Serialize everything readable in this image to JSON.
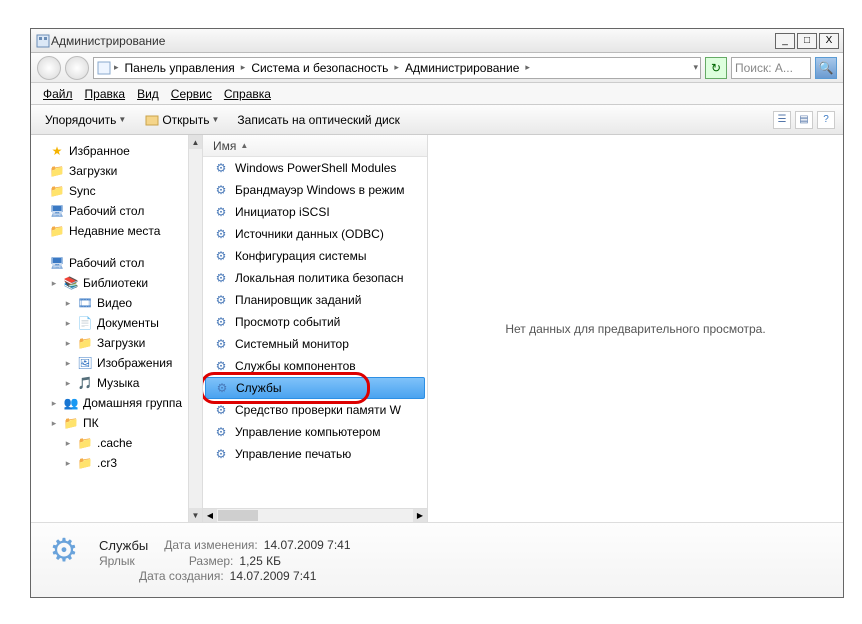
{
  "title": "Администрирование",
  "window_buttons": {
    "min": "_",
    "max": "□",
    "close": "X"
  },
  "breadcrumbs": [
    "Панель управления",
    "Система и безопасность",
    "Администрирование"
  ],
  "search_placeholder": "Поиск: А...",
  "menu": {
    "file": "Файл",
    "edit": "Правка",
    "view": "Вид",
    "service": "Сервис",
    "help": "Справка"
  },
  "toolbar": {
    "organize": "Упорядочить",
    "open": "Открыть",
    "burn": "Записать на оптический диск"
  },
  "tree": {
    "favorites": "Избранное",
    "downloads": "Загрузки",
    "sync": "Sync",
    "desktop_fav": "Рабочий стол",
    "recent": "Недавние места",
    "desktop": "Рабочий стол",
    "libraries": "Библиотеки",
    "video": "Видео",
    "documents": "Документы",
    "downloads2": "Загрузки",
    "images": "Изображения",
    "music": "Музыка",
    "homegroup": "Домашняя группа",
    "pc": "ПК",
    "cache": ".cache",
    "cr3": ".cr3"
  },
  "list_header": "Имя",
  "items": [
    "Windows PowerShell Modules",
    "Брандмауэр Windows в режим",
    "Инициатор iSCSI",
    "Источники данных (ODBC)",
    "Конфигурация системы",
    "Локальная политика безопасн",
    "Планировщик заданий",
    "Просмотр событий",
    "Системный монитор",
    "Службы компонентов",
    "Службы",
    "Средство проверки памяти W",
    "Управление компьютером",
    "Управление печатью"
  ],
  "preview_msg": "Нет данных для предварительного просмотра.",
  "details": {
    "name": "Службы",
    "type": "Ярлык",
    "mod_label": "Дата изменения:",
    "mod_value": "14.07.2009 7:41",
    "size_label": "Размер:",
    "size_value": "1,25 КБ",
    "create_label": "Дата создания:",
    "create_value": "14.07.2009 7:41"
  }
}
